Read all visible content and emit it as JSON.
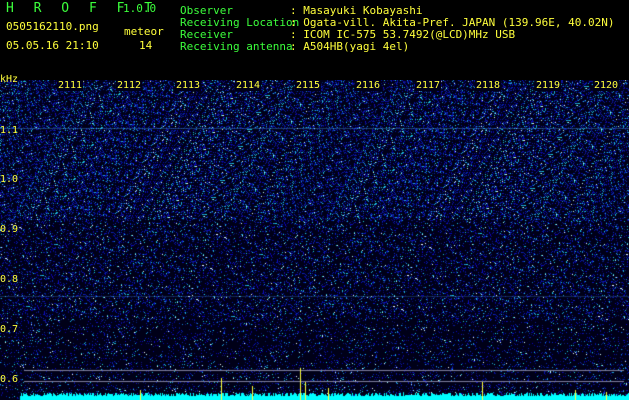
{
  "header": {
    "app_name": "H R O F F T",
    "version": "1.0.0",
    "file_name": "0505162110.png",
    "timestamp": "05.05.16 21:10",
    "meteor_label": "meteor",
    "meteor_count": "14",
    "info": [
      {
        "label": "Observer",
        "value": ": Masayuki Kobayashi"
      },
      {
        "label": "Receiving Location",
        "value": ": Ogata-vill. Akita-Pref. JAPAN (139.96E, 40.02N)"
      },
      {
        "label": "Receiver",
        "value": ": ICOM IC-575 53.7492(@LCD)MHz USB"
      },
      {
        "label": "Receiving antenna",
        "value": ": A504HB(yagi 4el)"
      }
    ]
  },
  "spectrogram": {
    "y_unit": "kHz",
    "y_ticks": [
      "1.1",
      "1.0",
      "0.9",
      "0.8",
      "0.7",
      "0.6"
    ],
    "time_ticks": [
      "2111",
      "2112",
      "2113",
      "2114",
      "2115",
      "2116",
      "2117",
      "2118",
      "2119",
      "2120"
    ]
  },
  "colors": {
    "label": "#3cff3c",
    "value": "#ffff3c",
    "background": "#000018",
    "signal_bar": "#00ffff"
  }
}
